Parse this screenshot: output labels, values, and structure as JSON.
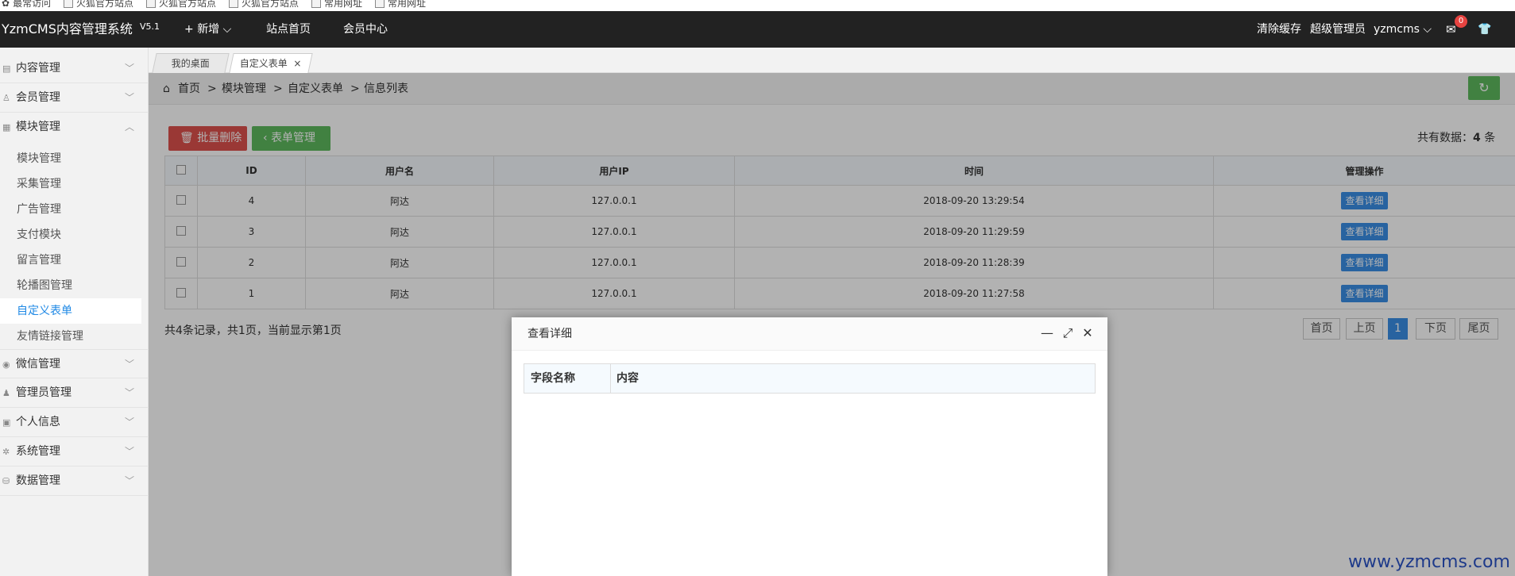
{
  "bookmarks": [
    {
      "label": "最常访问"
    },
    {
      "label": "火狐官方站点"
    },
    {
      "label": "火狐官方站点"
    },
    {
      "label": "火狐官方站点"
    },
    {
      "label": "常用网址"
    },
    {
      "label": "常用网址"
    }
  ],
  "header": {
    "brand": "YzmCMS内容管理系统",
    "version": "V5.1",
    "add_label": "新增",
    "site_home": "站点首页",
    "member_center": "会员中心",
    "clear_cache": "清除缓存",
    "role": "超级管理员",
    "user": "yzmcms",
    "message_count": "0",
    "icons": {
      "mail": "envelope-icon",
      "skin": "tshirt-icon"
    }
  },
  "sidebar": {
    "groups": [
      {
        "label": "内容管理",
        "icon": "content-icon"
      },
      {
        "label": "会员管理",
        "icon": "user-icon"
      },
      {
        "label": "模块管理",
        "icon": "module-icon"
      },
      {
        "label": "微信管理",
        "icon": "wechat-icon"
      },
      {
        "label": "管理员管理",
        "icon": "admin-icon"
      },
      {
        "label": "个人信息",
        "icon": "profile-icon"
      },
      {
        "label": "系统管理",
        "icon": "gear-icon"
      },
      {
        "label": "数据管理",
        "icon": "database-icon"
      }
    ],
    "module_items": [
      "模块管理",
      "采集管理",
      "广告管理",
      "支付模块",
      "留言管理",
      "轮播图管理",
      "自定义表单",
      "友情链接管理"
    ]
  },
  "tabs": {
    "t1": "我的桌面",
    "t2": "自定义表单"
  },
  "breadcrumb": {
    "home": "首页",
    "sep": ">",
    "b1": "模块管理",
    "b2": "自定义表单",
    "b3": "信息列表"
  },
  "toolbar": {
    "batch_delete": "批量删除",
    "form_manage": "表单管理",
    "total_prefix": "共有数据：",
    "total": "4",
    "total_suffix": " 条"
  },
  "table": {
    "headers": [
      "ID",
      "用户名",
      "用户IP",
      "时间",
      "管理操作"
    ],
    "rows": [
      {
        "id": "4",
        "user": "阿达",
        "ip": "127.0.0.1",
        "time": "2018-09-20 13:29:54",
        "action": "查看详细"
      },
      {
        "id": "3",
        "user": "阿达",
        "ip": "127.0.0.1",
        "time": "2018-09-20 11:29:59",
        "action": "查看详细"
      },
      {
        "id": "2",
        "user": "阿达",
        "ip": "127.0.0.1",
        "time": "2018-09-20 11:28:39",
        "action": "查看详细"
      },
      {
        "id": "1",
        "user": "阿达",
        "ip": "127.0.0.1",
        "time": "2018-09-20 11:27:58",
        "action": "查看详细"
      }
    ]
  },
  "summary": "共4条记录，共1页，当前显示第1页",
  "pagination": {
    "first": "首页",
    "prev": "上页",
    "current": "1",
    "next": "下页",
    "last": "尾页"
  },
  "modal": {
    "title": "查看详细",
    "col1": "字段名称",
    "col2": "内容"
  },
  "watermark": "www.yzmcms.com"
}
